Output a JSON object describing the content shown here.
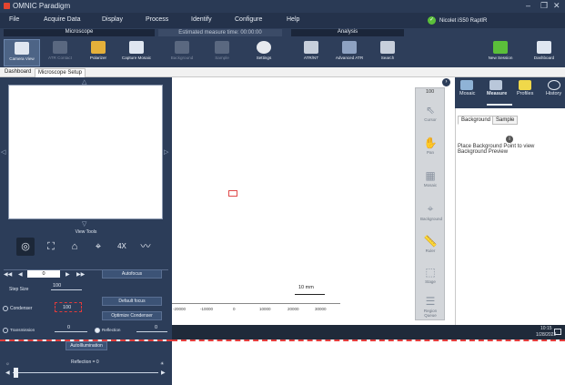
{
  "app": {
    "title": "OMNIC Paradigm",
    "instrument": "Nicolet iS50 RaptIR",
    "instrument_status": "connected"
  },
  "window_controls": {
    "minimize": "–",
    "restore": "❐",
    "close": "✕"
  },
  "menu": [
    "File",
    "Acquire Data",
    "Display",
    "Process",
    "Identify",
    "Configure",
    "Help"
  ],
  "ribbon": {
    "microscope_group": "Microscope",
    "analysis_group": "Analysis",
    "measure_time": "Estimated measure time: 00:00:00",
    "buttons": [
      {
        "label": "Camera View",
        "icon": "camera-icon",
        "state": "active"
      },
      {
        "label": "ATR Contact",
        "icon": "atr-contact-icon",
        "state": "disabled"
      },
      {
        "label": "Polarizer",
        "icon": "polarizer-icon",
        "state": "normal"
      },
      {
        "label": "Capture Mosaic",
        "icon": "mosaic-capture-icon",
        "state": "normal",
        "badge": "4X"
      },
      {
        "label": "Background",
        "icon": "background-icon",
        "state": "disabled"
      },
      {
        "label": "Sample",
        "icon": "sample-icon",
        "state": "disabled"
      },
      {
        "label": "Settings",
        "icon": "settings-icon",
        "state": "normal"
      },
      {
        "label": "ATR/NT",
        "icon": "atr-nt-icon",
        "state": "normal"
      },
      {
        "label": "Advanced ATR",
        "icon": "advanced-atr-icon",
        "state": "normal"
      },
      {
        "label": "Search",
        "icon": "search-icon",
        "state": "normal"
      },
      {
        "label": "New Session",
        "icon": "new-session-icon",
        "state": "normal"
      },
      {
        "label": "Dashboard",
        "icon": "dashboard-icon",
        "state": "normal"
      }
    ]
  },
  "tabs": [
    {
      "label": "Dashboard",
      "active": false
    },
    {
      "label": "Microscope Setup",
      "active": true
    }
  ],
  "left_panel": {
    "view_tools_label": "View Tools",
    "view_tools": [
      {
        "name": "aperture-icon",
        "glyph": "◎"
      },
      {
        "name": "frame-icon",
        "glyph": "⛶"
      },
      {
        "name": "stage-icon",
        "glyph": "⌂"
      },
      {
        "name": "crosshair-icon",
        "glyph": "⌖"
      },
      {
        "name": "zoom-4x",
        "glyph": "4X"
      },
      {
        "name": "spectrum-icon",
        "glyph": "〰"
      }
    ],
    "nav_value": "0",
    "autofocus_label": "Autofocus",
    "step_size_label": "Step Size",
    "step_size_value": "100",
    "condenser_label": "Condenser",
    "condenser_value": "100",
    "default_focus_label": "Default focus",
    "optimize_condenser_label": "Optimize Condenser",
    "transmission_label": "Transmission",
    "transmission_value": "0",
    "reflection_label": "Reflection",
    "reflection_value": "0",
    "autoillumination_label": "AutoIllumination",
    "reflection_slider_label": "Reflection = 0",
    "reflection_slider_level": 0.02
  },
  "center": {
    "scale_label": "10 mm",
    "axis_ticks": [
      "-20000",
      "-10000",
      "0",
      "10000",
      "20000",
      "30000"
    ]
  },
  "tools": [
    "Cursor",
    "Pan",
    "Mosaic",
    "Background",
    "Ruler",
    "Stage",
    "Region Queue"
  ],
  "center_top_value": "100",
  "right_panel": {
    "tabs": [
      "Mosaic",
      "Measure",
      "Profiles",
      "History"
    ],
    "selected_tab": "Measure",
    "subtabs": [
      "Background",
      "Sample"
    ],
    "selected_subtab": "Background",
    "info_text": "Place Background Point to view Background Preview"
  },
  "taskbar": {
    "time": "10:15",
    "date": "1/28/2022"
  },
  "colors": {
    "chrome": "#2c3d59",
    "menubar": "#24324b",
    "accent_red": "#e23b3b",
    "status_green": "#5bbf3a"
  }
}
